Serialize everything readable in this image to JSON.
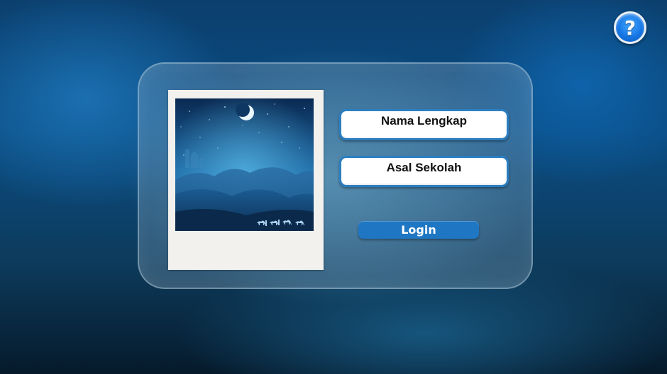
{
  "help": {
    "glyph": "?",
    "icon": "question-mark-icon"
  },
  "form": {
    "name_field_label": "Nama Lengkap",
    "school_field_label": "Asal Sekolah",
    "login_label": "Login"
  },
  "illustration": {
    "subject": "desert-night-crescent-moon-caravan-icon"
  },
  "colors": {
    "accent": "#1f77c4",
    "field_border": "#2c7fc2",
    "help_button": "#1677e6"
  }
}
